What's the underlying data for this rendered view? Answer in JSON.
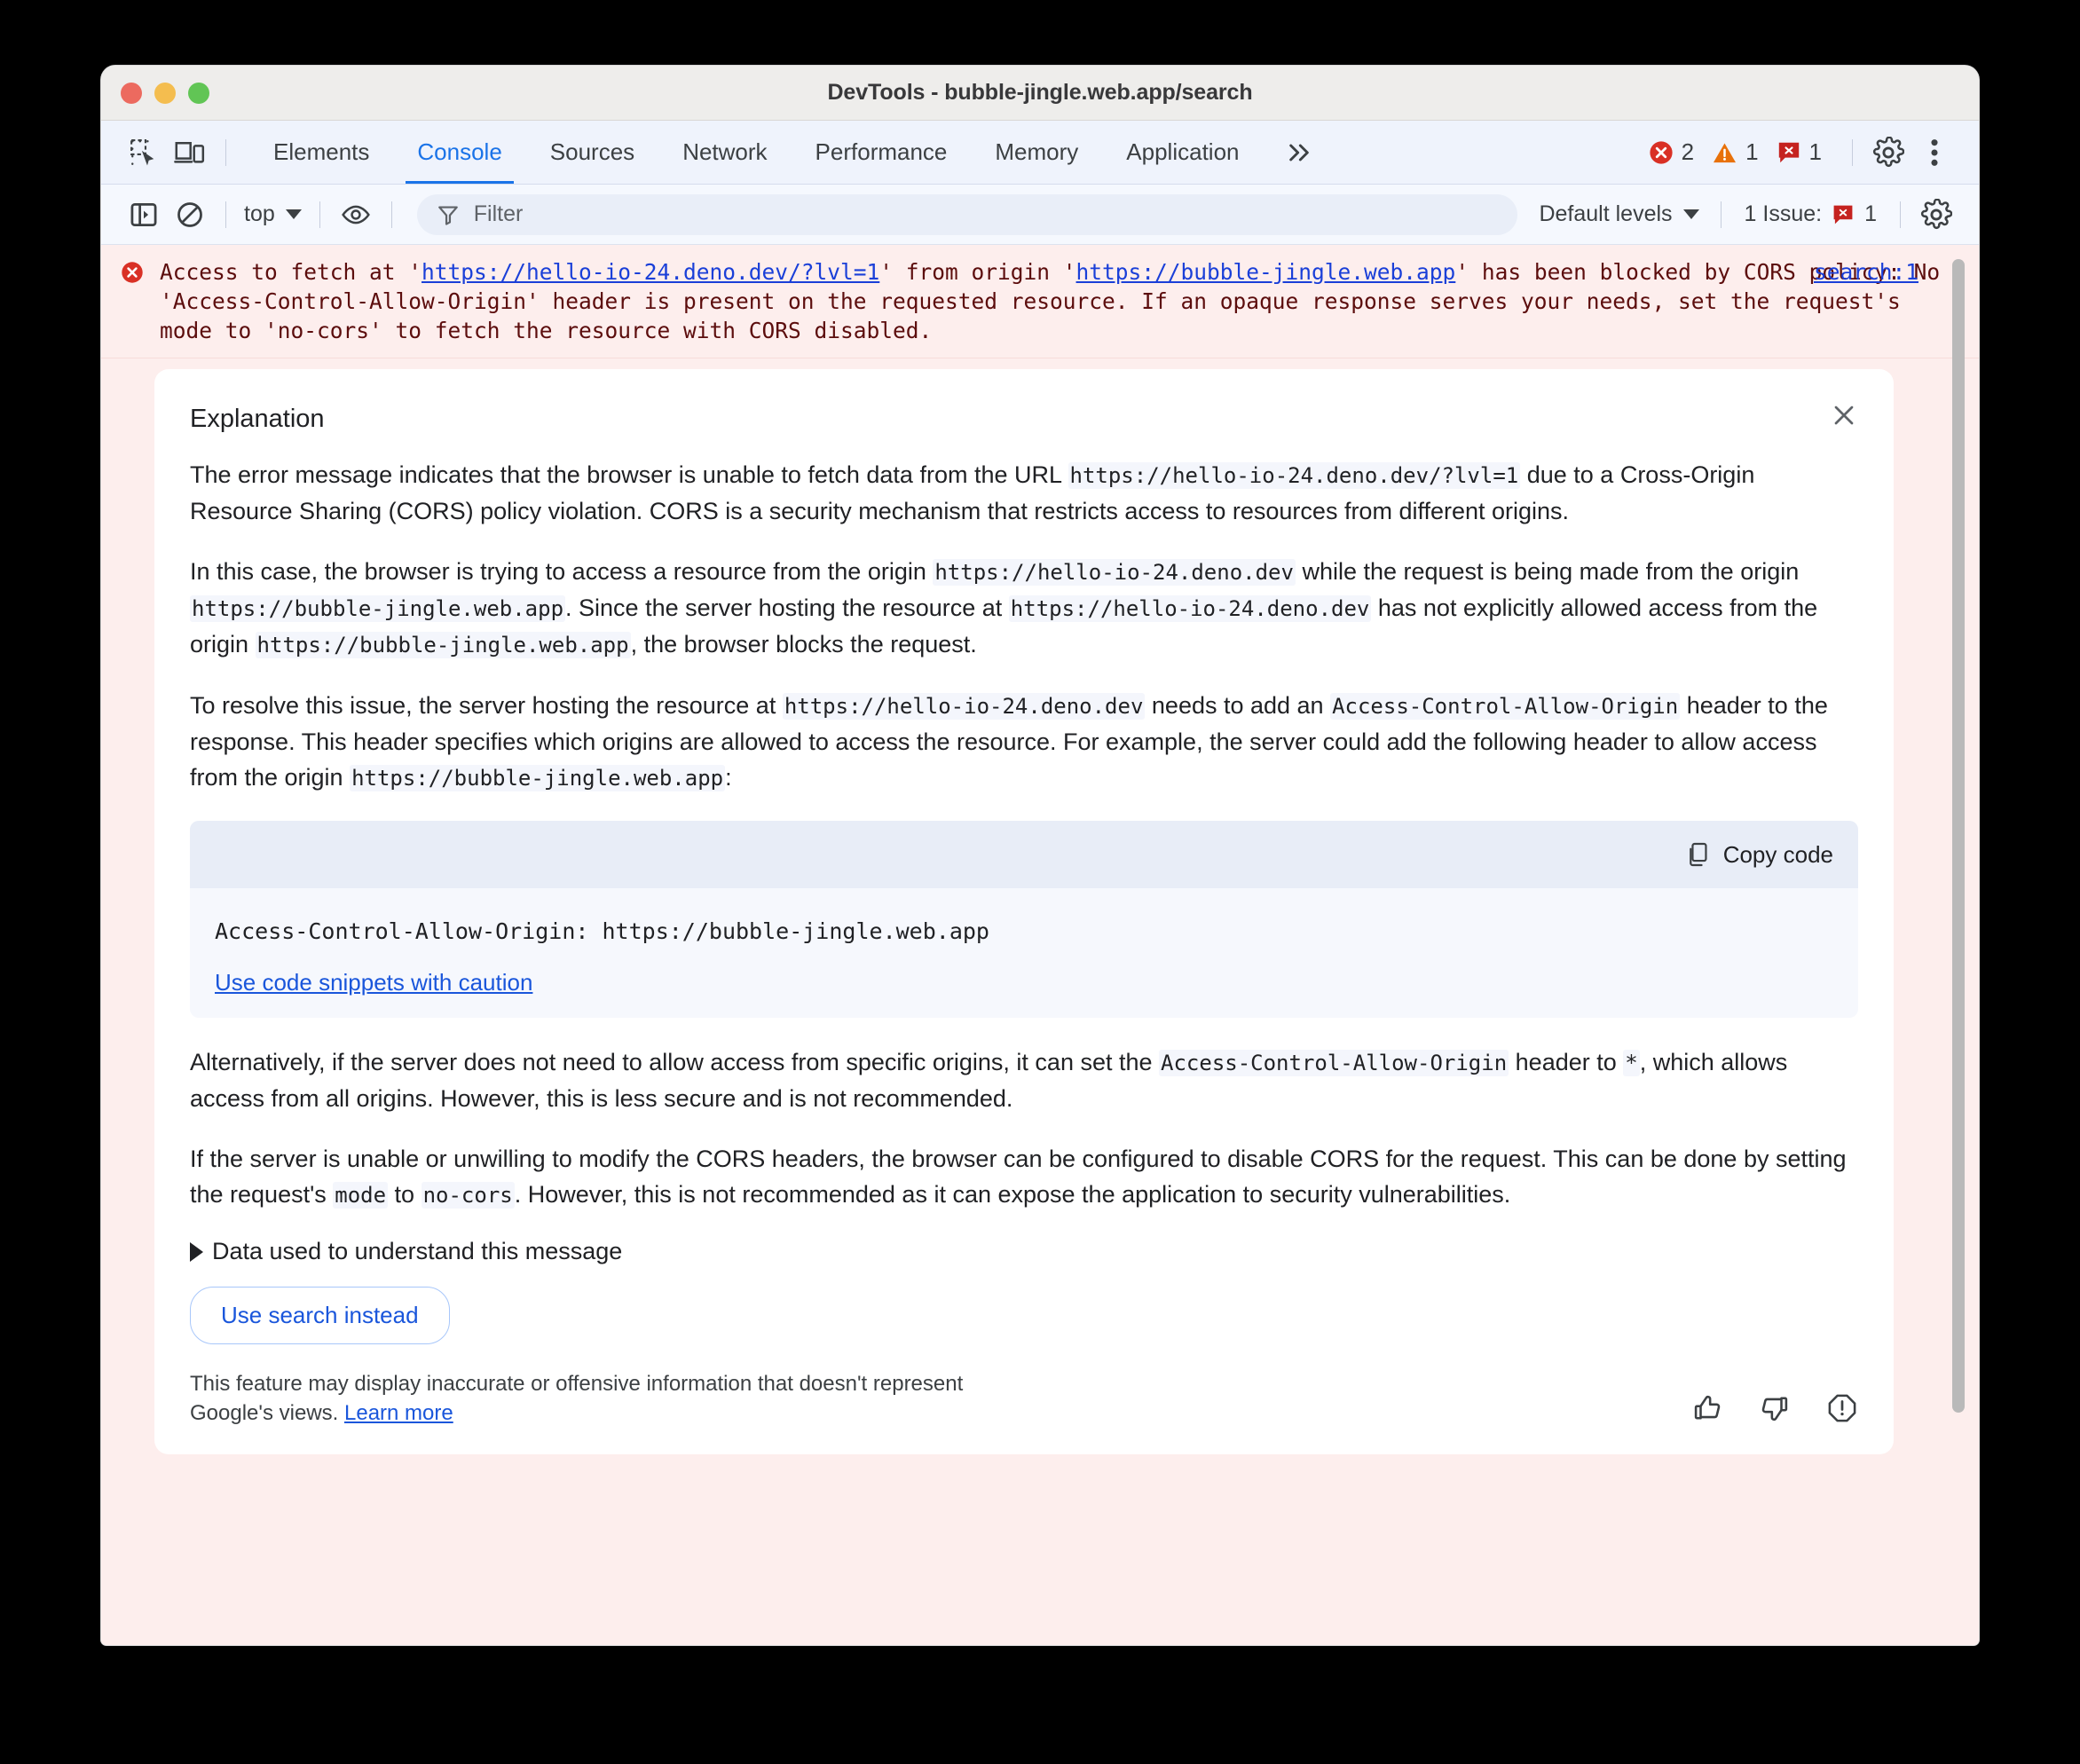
{
  "window": {
    "title": "DevTools - bubble-jingle.web.app/search",
    "traffic_lights": [
      "close",
      "minimize",
      "zoom"
    ]
  },
  "tabbar": {
    "inspect_icon": "inspect-element-icon",
    "device_icon": "device-toolbar-icon",
    "tabs": [
      {
        "label": "Elements",
        "active": false
      },
      {
        "label": "Console",
        "active": true
      },
      {
        "label": "Sources",
        "active": false
      },
      {
        "label": "Network",
        "active": false
      },
      {
        "label": "Performance",
        "active": false
      },
      {
        "label": "Memory",
        "active": false
      },
      {
        "label": "Application",
        "active": false
      }
    ],
    "more_tabs_label": "»",
    "counters": [
      {
        "icon": "error-icon",
        "count": "2"
      },
      {
        "icon": "warning-icon",
        "count": "1"
      },
      {
        "icon": "issue-icon",
        "count": "1"
      }
    ],
    "settings_icon": "gear-icon",
    "more_options_icon": "kebab-menu-icon"
  },
  "console_toolbar": {
    "sidebar_icon": "console-sidebar-icon",
    "clear_icon": "clear-console-icon",
    "context": "top",
    "eye_icon": "live-expression-icon",
    "filter": {
      "icon": "filter-icon",
      "placeholder": "Filter",
      "value": ""
    },
    "levels_label": "Default levels",
    "issues_label": "1 Issue:",
    "issues_count": "1",
    "settings_icon": "gear-icon"
  },
  "console_error": {
    "icon": "error-icon",
    "part1": "Access to fetch at '",
    "url1": "https://hello-io-24.deno.dev/?lvl=1",
    "part2": "' from origin '",
    "url2": "https://bubble-jingle.web.app",
    "part3": "' has been blocked by CORS policy: No 'Access-Control-Allow-Origin' header is present on the requested resource. If an opaque response serves your needs, set the request's mode to 'no-cors' to fetch the resource with CORS disabled.",
    "source_link": "search:1"
  },
  "explanation": {
    "heading": "Explanation",
    "close_icon": "close-icon",
    "paragraph1": {
      "a": "The error message indicates that the browser is unable to fetch data from the URL ",
      "code1": "https://hello-io-24.deno.dev/?lvl=1",
      "b": " due to a Cross-Origin Resource Sharing (CORS) policy violation. CORS is a security mechanism that restricts access to resources from different origins."
    },
    "paragraph2": {
      "a": "In this case, the browser is trying to access a resource from the origin ",
      "code1": "https://hello-io-24.deno.dev",
      "b": " while the request is being made from the origin ",
      "code2": "https://bubble-jingle.web.app",
      "c": ". Since the server hosting the resource at ",
      "code3": "https://hello-io-24.deno.dev",
      "d": " has not explicitly allowed access from the origin ",
      "code4": "https://bubble-jingle.web.app",
      "e": ", the browser blocks the request."
    },
    "paragraph3": {
      "a": "To resolve this issue, the server hosting the resource at ",
      "code1": "https://hello-io-24.deno.dev",
      "b": " needs to add an ",
      "code2": "Access-Control-Allow-Origin",
      "c": " header to the response. This header specifies which origins are allowed to access the resource. For example, the server could add the following header to allow access from the origin ",
      "code3": "https://bubble-jingle.web.app",
      "d": ":"
    },
    "code_block": {
      "copy_icon": "copy-icon",
      "copy_label": "Copy code",
      "code": "Access-Control-Allow-Origin: https://bubble-jingle.web.app",
      "caution_link": "Use code snippets with caution"
    },
    "paragraph4": {
      "a": "Alternatively, if the server does not need to allow access from specific origins, it can set the ",
      "code1": "Access-Control-Allow-Origin",
      "b": " header to ",
      "code2": "*",
      "c": ", which allows access from all origins. However, this is less secure and is not recommended."
    },
    "paragraph5": {
      "a": "If the server is unable or unwilling to modify the CORS headers, the browser can be configured to disable CORS for the request. This can be done by setting the request's ",
      "code1": "mode",
      "b": " to ",
      "code2": "no-cors",
      "c": ". However, this is not recommended as it can expose the application to security vulnerabilities."
    },
    "disclosure_label": "Data used to understand this message",
    "button_label": "Use search instead",
    "disclaimer": {
      "text": "This feature may display inaccurate or offensive information that doesn't represent Google's views. ",
      "link": "Learn more"
    },
    "feedback": [
      {
        "icon": "thumb-up-icon"
      },
      {
        "icon": "thumb-down-icon"
      },
      {
        "icon": "report-icon"
      }
    ]
  },
  "colors": {
    "accent": "#1a73e8",
    "error_bg": "#fdeeed",
    "error_text": "#5c0d0d",
    "link": "#1a56db",
    "tabbar_bg": "#eff3fc"
  }
}
